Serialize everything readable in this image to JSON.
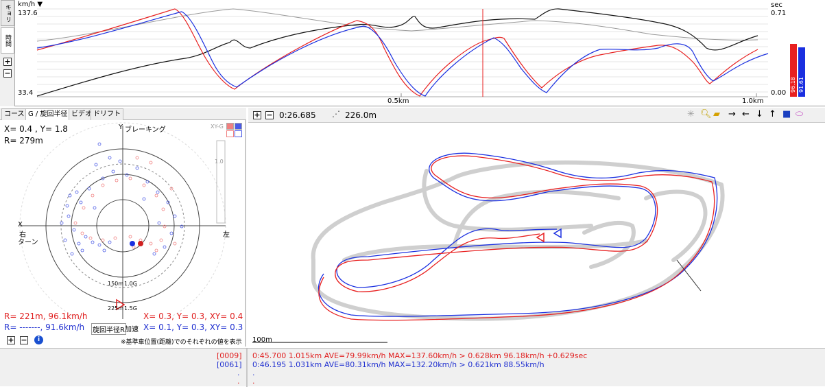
{
  "top_chart": {
    "y_unit": "km/h",
    "y_max": "137.6",
    "y_min": "33.4",
    "right_unit": "sec",
    "right_max": "0.71",
    "right_min": "0.00",
    "x_ticks": [
      "0.5km",
      "1.0km"
    ],
    "side_tabs": [
      "キョリ",
      "時間"
    ],
    "bar_values": [
      "96.18",
      "91.61"
    ],
    "colors": {
      "red": "#e82020",
      "blue": "#1a2fe0",
      "black": "#111111",
      "gray": "#999999"
    }
  },
  "g_panel": {
    "tabs": [
      "コース",
      "G / 旋回半径",
      "ビデオ",
      "ドリフト"
    ],
    "xy_readout": "X=  0.4 , Y=  1.8",
    "r_readout": "R= 279m",
    "braking_label": "ブレーキング",
    "y_axis": "Y",
    "x_axis": "X",
    "right_turn": "右",
    "turn": "ターン",
    "left": "左",
    "scale_top": "1.0",
    "xyg_label": "XY-G",
    "ring_label_150": "150m",
    "ring_label_1g": "1.0G",
    "ring_label_225": "225m",
    "ring_label_15g": "1.5G",
    "red_r": "R= 221m,  96.1km/h",
    "red_xy": "X=  0.3,  Y=   0.3,  XY= 0.4",
    "blue_r": "R= -------,  91.6km/h",
    "blue_xy": "X=  0.1,  Y=   0.3,  XY= 0.3",
    "turn_radius_btn": "旋回半径R",
    "accel_btn": "加速",
    "footnote": "※基準車位置(距離)でのそれぞれの値を表示"
  },
  "map_panel": {
    "time": "0:26.685",
    "distance": "226.0m",
    "scale_bar": "100m"
  },
  "laps": [
    {
      "id": "[0009]",
      "text": "0:45.700 1.015km AVE=79.99km/h MAX=137.60km/h > 0.628km 96.18km/h +0.629sec",
      "color": "red"
    },
    {
      "id": "[0061]",
      "text": "0:46.195 1.031km AVE=80.31km/h MAX=132.20km/h > 0.621km 88.55km/h",
      "color": "blue"
    }
  ],
  "dots": [
    ".",
    "."
  ]
}
